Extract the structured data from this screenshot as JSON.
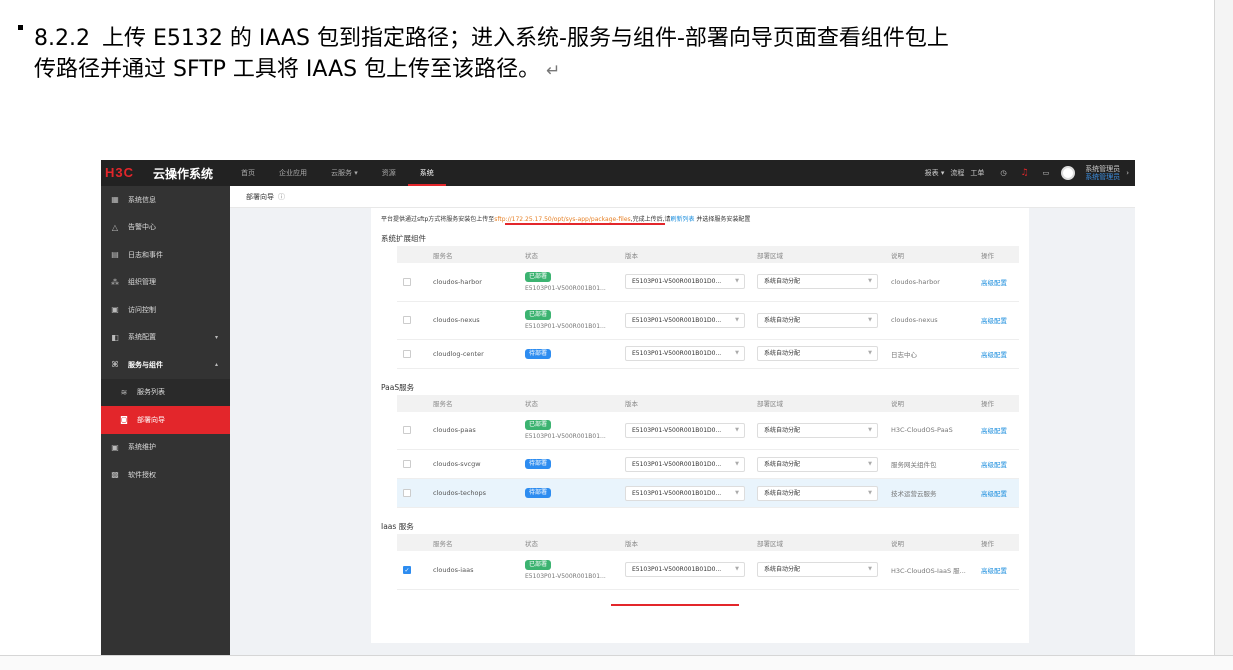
{
  "doc": {
    "heading_number": "8.2.2",
    "heading_line1": "上传 E5132 的 IAAS 包到指定路径；进入系统-服务与组件-部署向导页面查看组件包上",
    "heading_line2": "传路径并通过 SFTP 工具将 IAAS 包上传至该路径。",
    "return_mark": "↵"
  },
  "app": {
    "logo": "H3C",
    "product": "云操作系统",
    "nav": [
      "首页",
      "企业应用",
      "云服务 ▾",
      "资源",
      "系统"
    ],
    "nav_active": 4,
    "right_tools": {
      "reports": "报表 ▾",
      "process": "流程",
      "ticket": "工单",
      "clock_icon": "clock-icon",
      "bell_icon": "bell-icon",
      "screen_icon": "screen-icon"
    },
    "user_name": "系统管理员",
    "user_role": "系统管理员",
    "colors": {
      "brand": "#e3262b",
      "topbar": "#222222",
      "sidebar": "#333333",
      "link": "#1a8ddd",
      "deployed": "#3cb371",
      "pending": "#2d8cf0"
    }
  },
  "sidebar": {
    "items": [
      {
        "label": "系统信息",
        "icon": "info-icon"
      },
      {
        "label": "告警中心",
        "icon": "alert-icon"
      },
      {
        "label": "日志和事件",
        "icon": "log-icon"
      },
      {
        "label": "组织管理",
        "icon": "org-icon"
      },
      {
        "label": "访问控制",
        "icon": "access-icon"
      },
      {
        "label": "系统配置",
        "icon": "config-icon",
        "caret": "▾"
      },
      {
        "label": "服务与组件",
        "icon": "service-icon",
        "caret": "▴"
      },
      {
        "label": "服务列表",
        "icon": "layers-icon"
      },
      {
        "label": "部署向导",
        "icon": "deploy-icon"
      },
      {
        "label": "系统维护",
        "icon": "maintain-icon"
      },
      {
        "label": "软件授权",
        "icon": "license-icon"
      }
    ]
  },
  "page": {
    "title": "部署向导",
    "help_icon": "question-icon",
    "notice_prefix": "平台提供通过sftp方式将服务安装包上传至",
    "notice_path": "sftp://172.25.17.50/opt/sys-app/package-files",
    "notice_mid": ",完成上传后,请",
    "notice_link": "刷新列表",
    "notice_suffix": "并选择服务安装配置"
  },
  "columns": [
    "服务名",
    "状态",
    "版本",
    "部署区域",
    "说明",
    "操作"
  ],
  "sections": [
    {
      "title": "系统扩展组件",
      "rows": [
        {
          "name": "cloudos-harbor",
          "status": "已部署",
          "status_type": "deployed",
          "sub_version": "E5103P01-V500R001B01...",
          "version": "E5103P01-V500R001B01D0...",
          "zone": "系统自动分配",
          "desc": "cloudos-harbor",
          "action": "高级配置",
          "checked": false,
          "highlight": false
        },
        {
          "name": "cloudos-nexus",
          "status": "已部署",
          "status_type": "deployed",
          "sub_version": "E5103P01-V500R001B01...",
          "version": "E5103P01-V500R001B01D0...",
          "zone": "系统自动分配",
          "desc": "cloudos-nexus",
          "action": "高级配置",
          "checked": false,
          "highlight": false
        },
        {
          "name": "cloudlog-center",
          "status": "待部署",
          "status_type": "pending",
          "sub_version": "",
          "version": "E5103P01-V500R001B01D0...",
          "zone": "系统自动分配",
          "desc": "日志中心",
          "action": "高级配置",
          "checked": false,
          "highlight": false
        }
      ]
    },
    {
      "title": "PaaS服务",
      "rows": [
        {
          "name": "cloudos-paas",
          "status": "已部署",
          "status_type": "deployed",
          "sub_version": "E5103P01-V500R001B01...",
          "version": "E5103P01-V500R001B01D0...",
          "zone": "系统自动分配",
          "desc": "H3C-CloudOS-PaaS",
          "action": "高级配置",
          "checked": false,
          "highlight": false
        },
        {
          "name": "cloudos-svcgw",
          "status": "待部署",
          "status_type": "pending",
          "sub_version": "",
          "version": "E5103P01-V500R001B01D0...",
          "zone": "系统自动分配",
          "desc": "服务网关组件包",
          "action": "高级配置",
          "checked": false,
          "highlight": false
        },
        {
          "name": "cloudos-techops",
          "status": "待部署",
          "status_type": "pending",
          "sub_version": "",
          "version": "E5103P01-V500R001B01D0...",
          "zone": "系统自动分配",
          "desc": "技术运营云服务",
          "action": "高级配置",
          "checked": false,
          "highlight": true
        }
      ]
    },
    {
      "title": "Iaas 服务",
      "rows": [
        {
          "name": "cloudos-iaas",
          "status": "已部署",
          "status_type": "deployed",
          "sub_version": "E5103P01-V500R001B01...",
          "version": "E5103P01-V500R001B01D0...",
          "zone": "系统自动分配",
          "desc": "H3C-CloudOS-IaaS 服...",
          "action": "高级配置",
          "checked": true,
          "highlight": false
        }
      ]
    }
  ]
}
